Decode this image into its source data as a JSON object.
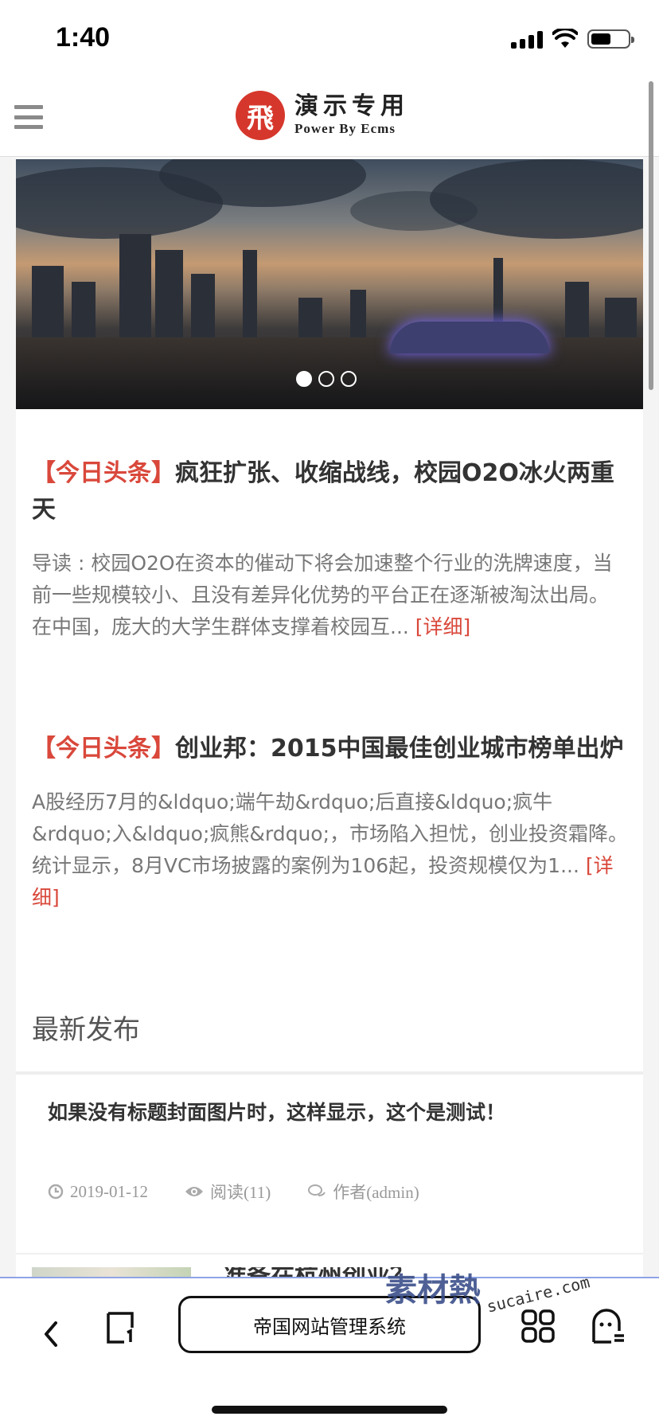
{
  "status": {
    "time": "1:40"
  },
  "header": {
    "logo_mark": "飛",
    "logo_title": "演示专用",
    "logo_subtitle": "Power By Ecms"
  },
  "banner": {
    "dot_count": 3,
    "active_dot": 0
  },
  "headlines": [
    {
      "tag": "【今日头条】",
      "title": "疯狂扩张、收缩战线，校园O2O冰火两重天",
      "desc": "导读 : 校园O2O在资本的催动下将会加速整个行业的洗牌速度，当前一些规模较小、且没有差异化优势的平台正在逐渐被淘汰出局。 在中国，庞大的大学生群体支撑着校园互...",
      "more": "[详细]"
    },
    {
      "tag": "【今日头条】",
      "title": "创业邦：2015中国最佳创业城市榜单出炉",
      "desc": "A股经历7月的&ldquo;端午劫&rdquo;后直接&ldquo;疯牛&rdquo;入&ldquo;疯熊&rdquo;，市场陷入担忧，创业投资霜降。统计显示，8月VC市场披露的案例为106起，投资规模仅为1...",
      "more": "[详细]"
    }
  ],
  "latest": {
    "section_title": "最新发布",
    "items": [
      {
        "title": "如果没有标题封面图片时，这样显示，这个是测试！",
        "date": "2019-01-12",
        "views": "阅读(11)",
        "author": "作者(admin)"
      }
    ],
    "next_title": "准备在杭州创业？"
  },
  "toolbar": {
    "url_text": "帝国网站管理系统",
    "watermark_cn": "素材熱",
    "watermark_en": "sucaire.com"
  },
  "colors": {
    "accent": "#d9483b",
    "logo_red": "#d6372c"
  },
  "icons": [
    "menu-icon",
    "back-icon",
    "tabs-icon",
    "grid-icon",
    "ghost-icon",
    "clock-icon",
    "eye-icon",
    "comment-icon"
  ]
}
